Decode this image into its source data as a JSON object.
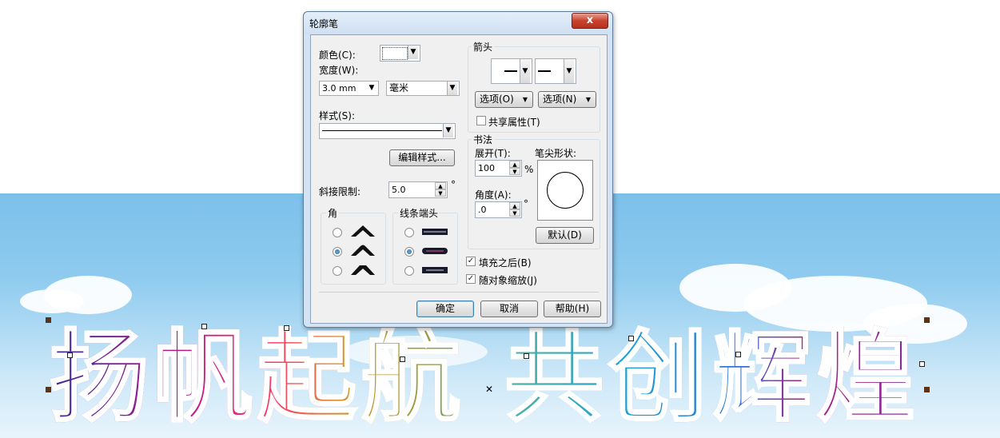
{
  "dialog": {
    "title": "轮廓笔",
    "close_symbol": "x"
  },
  "color": {
    "label": "颜色(C):",
    "swatch_color": "#ffffff"
  },
  "width": {
    "label": "宽度(W):",
    "value": "3.0 mm",
    "unit": "毫米"
  },
  "style": {
    "label": "样式(S):"
  },
  "edit_style_button": "编辑样式...",
  "miter": {
    "label": "斜接限制:",
    "value": "5.0",
    "unit": "°"
  },
  "corners": {
    "title": "角",
    "selected_index": 1
  },
  "line_caps": {
    "title": "线条端头",
    "selected_index": 1
  },
  "arrows": {
    "title": "箭头",
    "options_left": "选项(O)",
    "options_right": "选项(N)",
    "share_attributes": "共享属性(T)",
    "share_attributes_checked": false
  },
  "calligraphy": {
    "title": "书法",
    "stretch_label": "展开(T):",
    "stretch_value": "100",
    "stretch_unit": "%",
    "nib_label": "笔尖形状:",
    "angle_label": "角度(A):",
    "angle_value": ".0",
    "angle_unit": "°",
    "default_button": "默认(D)"
  },
  "behind_fill": {
    "label": "填充之后(B)",
    "checked": true
  },
  "scale_with_object": {
    "label": "随对象缩放(J)",
    "checked": true
  },
  "footer": {
    "ok": "确定",
    "cancel": "取消",
    "help": "帮助(H)"
  },
  "background": {
    "banner_text": "扬帆起航 共创辉煌",
    "sky_color": "#7cc0ea"
  }
}
